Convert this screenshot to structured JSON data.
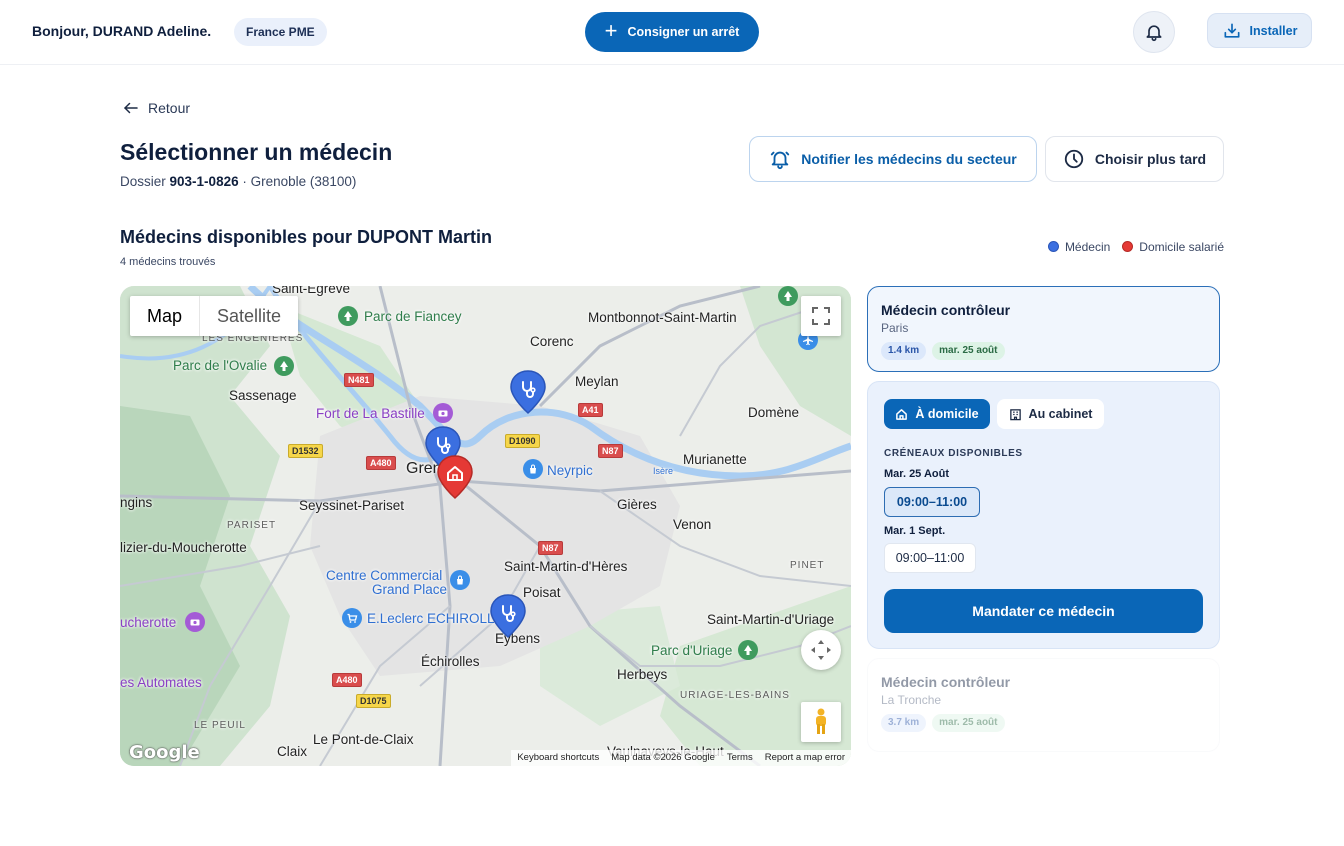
{
  "header": {
    "greeting": "Bonjour, DURAND Adeline.",
    "org": "France PME",
    "cta_label": "Consigner un arrêt",
    "install_label": "Installer"
  },
  "page": {
    "back_label": "Retour",
    "title": "Sélectionner un médecin",
    "dossier_prefix": "Dossier",
    "dossier_number": "903-1-0826",
    "dossier_location": "· Grenoble (38100)",
    "notify_label": "Notifier les médecins du secteur",
    "later_label": "Choisir plus tard"
  },
  "section": {
    "title": "Médecins disponibles pour DUPONT Martin",
    "count": "4 médecins trouvés",
    "legend": [
      {
        "label": "Médecin",
        "color": "#3b6fe0"
      },
      {
        "label": "Domicile salarié",
        "color": "#e53935"
      }
    ]
  },
  "map": {
    "type_map": "Map",
    "type_satellite": "Satellite",
    "logo": "Google",
    "attribution": [
      "Keyboard shortcuts",
      "Map data ©2026 Google",
      "Terms",
      "Report a map error"
    ],
    "places": [
      {
        "text": "Saint-Égrève",
        "cls": "bold"
      },
      {
        "text": "Parc de Fiancey",
        "cls": "green"
      },
      {
        "text": "Montbonnot-Saint-Martin",
        "cls": "bold"
      },
      {
        "text": "LES ENGENIERES",
        "cls": "small"
      },
      {
        "text": "Corenc",
        "cls": "bold"
      },
      {
        "text": "Parc de l'Ovalie",
        "cls": "green"
      },
      {
        "text": "Meylan",
        "cls": "bold"
      },
      {
        "text": "Sassenage",
        "cls": "bold"
      },
      {
        "text": "Fort de La Bastille",
        "cls": "purple"
      },
      {
        "text": "Domène",
        "cls": "bold"
      },
      {
        "text": "Grenoble",
        "cls": "bold"
      },
      {
        "text": "Neyrpic",
        "cls": "blue"
      },
      {
        "text": "Murianette",
        "cls": "bold"
      },
      {
        "text": "Isère",
        "cls": "blue"
      },
      {
        "text": "ngins",
        "cls": "bold"
      },
      {
        "text": "Seyssinet-Pariset",
        "cls": "bold"
      },
      {
        "text": "Gières",
        "cls": "bold"
      },
      {
        "text": "PARISET",
        "cls": "small"
      },
      {
        "text": "Venon",
        "cls": "bold"
      },
      {
        "text": "lizier-du-Moucherotte",
        "cls": "bold"
      },
      {
        "text": "Centre Commercial",
        "cls": "blue"
      },
      {
        "text": "Grand Place",
        "cls": "blue"
      },
      {
        "text": "Saint-Martin-d'Hères",
        "cls": "bold"
      },
      {
        "text": "PINET",
        "cls": "small"
      },
      {
        "text": "Poisat",
        "cls": "bold"
      },
      {
        "text": "ucherotte",
        "cls": "purple"
      },
      {
        "text": "E.Leclerc ECHIROLLES",
        "cls": "blue"
      },
      {
        "text": "Eybens",
        "cls": "bold"
      },
      {
        "text": "Saint-Martin-d'Uriage",
        "cls": "bold"
      },
      {
        "text": "Parc d'Uriage",
        "cls": "green"
      },
      {
        "text": "Échirolles",
        "cls": "bold"
      },
      {
        "text": "Herbeys",
        "cls": "bold"
      },
      {
        "text": "es Automates",
        "cls": "purple"
      },
      {
        "text": "URIAGE-LES-BAINS",
        "cls": "small"
      },
      {
        "text": "LE PEUIL",
        "cls": "small"
      },
      {
        "text": "Claix",
        "cls": "bold"
      },
      {
        "text": "Le Pont-de-Claix",
        "cls": "bold"
      },
      {
        "text": "Vaulnaveys-le-Haut",
        "cls": "bold"
      }
    ],
    "roads": [
      "N481",
      "A41",
      "D1090",
      "D1532",
      "A480",
      "N87",
      "N87",
      "A480",
      "D1075"
    ]
  },
  "doctors": [
    {
      "name": "Médecin contrôleur",
      "city": "Paris",
      "distance": "1.4 km",
      "date": "mar. 25 août"
    },
    {
      "name": "Médecin contrôleur",
      "city": "La Tronche",
      "distance": "3.7 km",
      "date": "mar. 25 août"
    }
  ],
  "slots": {
    "mode_home": "À domicile",
    "mode_office": "Au cabinet",
    "title": "CRÉNEAUX DISPONIBLES",
    "day1": "Mar. 25 Août",
    "day1_slot": "09:00–11:00",
    "day2": "Mar. 1 Sept.",
    "day2_slot": "09:00–11:00",
    "mandate_label": "Mandater ce médecin"
  },
  "colors": {
    "primary": "#0a66b7",
    "doctor_pin": "#3b6fe0",
    "home_pin": "#e53935"
  }
}
